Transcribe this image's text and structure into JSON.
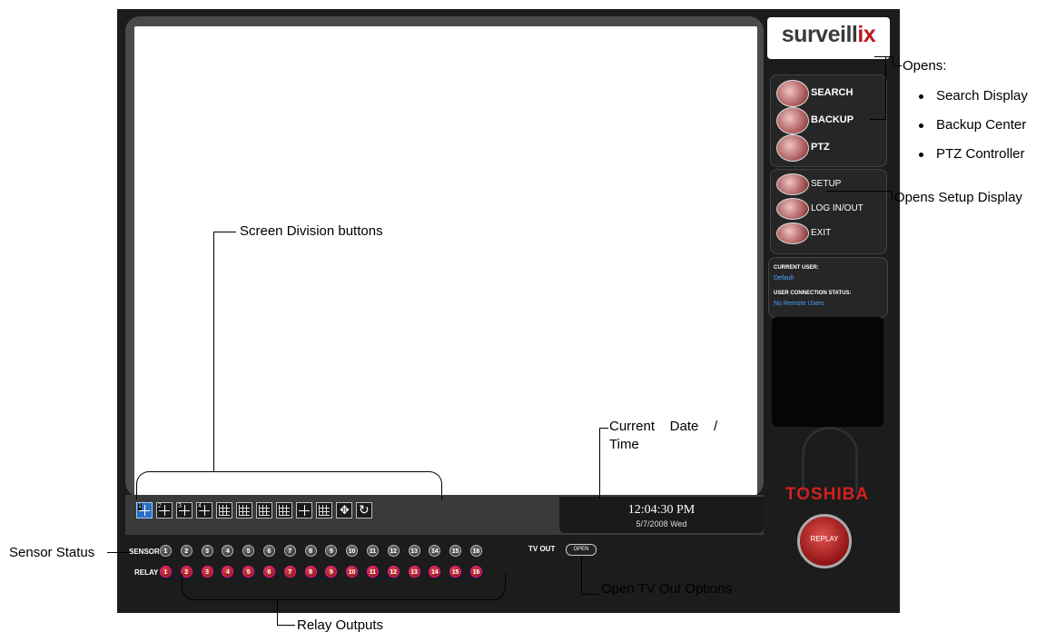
{
  "brand": {
    "logo_prefix": "surveill",
    "logo_accent": "ix",
    "maker": "TOSHIBA",
    "accent_color": "#c0161c"
  },
  "menu": {
    "search": "SEARCH",
    "backup": "BACKUP",
    "ptz": "PTZ",
    "setup": "SETUP",
    "login": "LOG IN/OUT",
    "exit": "EXIT"
  },
  "status": {
    "current_user_label": "CURRENT USER:",
    "current_user": "Default",
    "conn_label": "USER CONNECTION STATUS:",
    "conn_value": "No Remote Users"
  },
  "clock": {
    "time": "12:04:30 PM",
    "date": "5/7/2008 Wed"
  },
  "io": {
    "sensor_label": "SENSOR",
    "relay_label": "RELAY",
    "sensors": [
      "1",
      "2",
      "3",
      "4",
      "5",
      "6",
      "7",
      "8",
      "9",
      "10",
      "11",
      "12",
      "13",
      "14",
      "15",
      "16"
    ],
    "relays": [
      "1",
      "2",
      "3",
      "4",
      "5",
      "6",
      "7",
      "8",
      "9",
      "10",
      "11",
      "12",
      "13",
      "14",
      "15",
      "16"
    ],
    "tvout_label": "TV OUT",
    "tvout_button": "OPEN"
  },
  "division_buttons": [
    "1",
    "2",
    "3",
    "4",
    "",
    "",
    "",
    "",
    "",
    "",
    "",
    ""
  ],
  "replay": "REPLAY",
  "annotations": {
    "opens": "Opens:",
    "opens_items": [
      "Search Display",
      "Backup Center",
      "PTZ Controller"
    ],
    "setup": "Opens Setup Display",
    "screen_division": "Screen Division buttons",
    "datetime_line1": "Current    Date    /",
    "datetime_line2": "Time",
    "sensor_status": "Sensor Status",
    "relay_outputs": "Relay Outputs",
    "tv_out": "Open TV Out Options"
  }
}
